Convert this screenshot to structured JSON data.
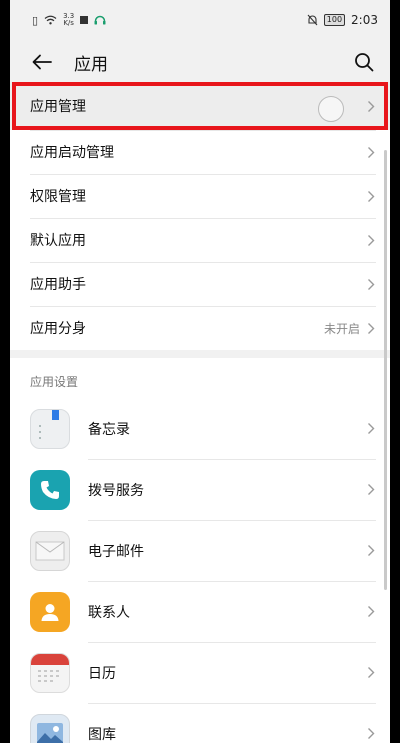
{
  "status_bar": {
    "speed_value": "3.3",
    "speed_unit": "K/s",
    "battery": "100",
    "time": "2:03"
  },
  "appbar": {
    "title": "应用"
  },
  "menu": [
    {
      "label": "应用管理",
      "value": ""
    },
    {
      "label": "应用启动管理",
      "value": ""
    },
    {
      "label": "权限管理",
      "value": ""
    },
    {
      "label": "默认应用",
      "value": ""
    },
    {
      "label": "应用助手",
      "value": ""
    },
    {
      "label": "应用分身",
      "value": "未开启"
    }
  ],
  "app_settings": {
    "header": "应用设置",
    "apps": [
      {
        "label": "备忘录",
        "icon": "memo-icon"
      },
      {
        "label": "拨号服务",
        "icon": "phone-icon"
      },
      {
        "label": "电子邮件",
        "icon": "mail-icon"
      },
      {
        "label": "联系人",
        "icon": "contact-icon"
      },
      {
        "label": "日历",
        "icon": "calendar-icon"
      },
      {
        "label": "图库",
        "icon": "gallery-icon"
      }
    ]
  },
  "colors": {
    "highlight": "#e8151b",
    "dial": "#1aa3b0",
    "contact": "#f5a623",
    "calendar": "#d9433b",
    "memo_bookmark": "#2e7ce6"
  }
}
